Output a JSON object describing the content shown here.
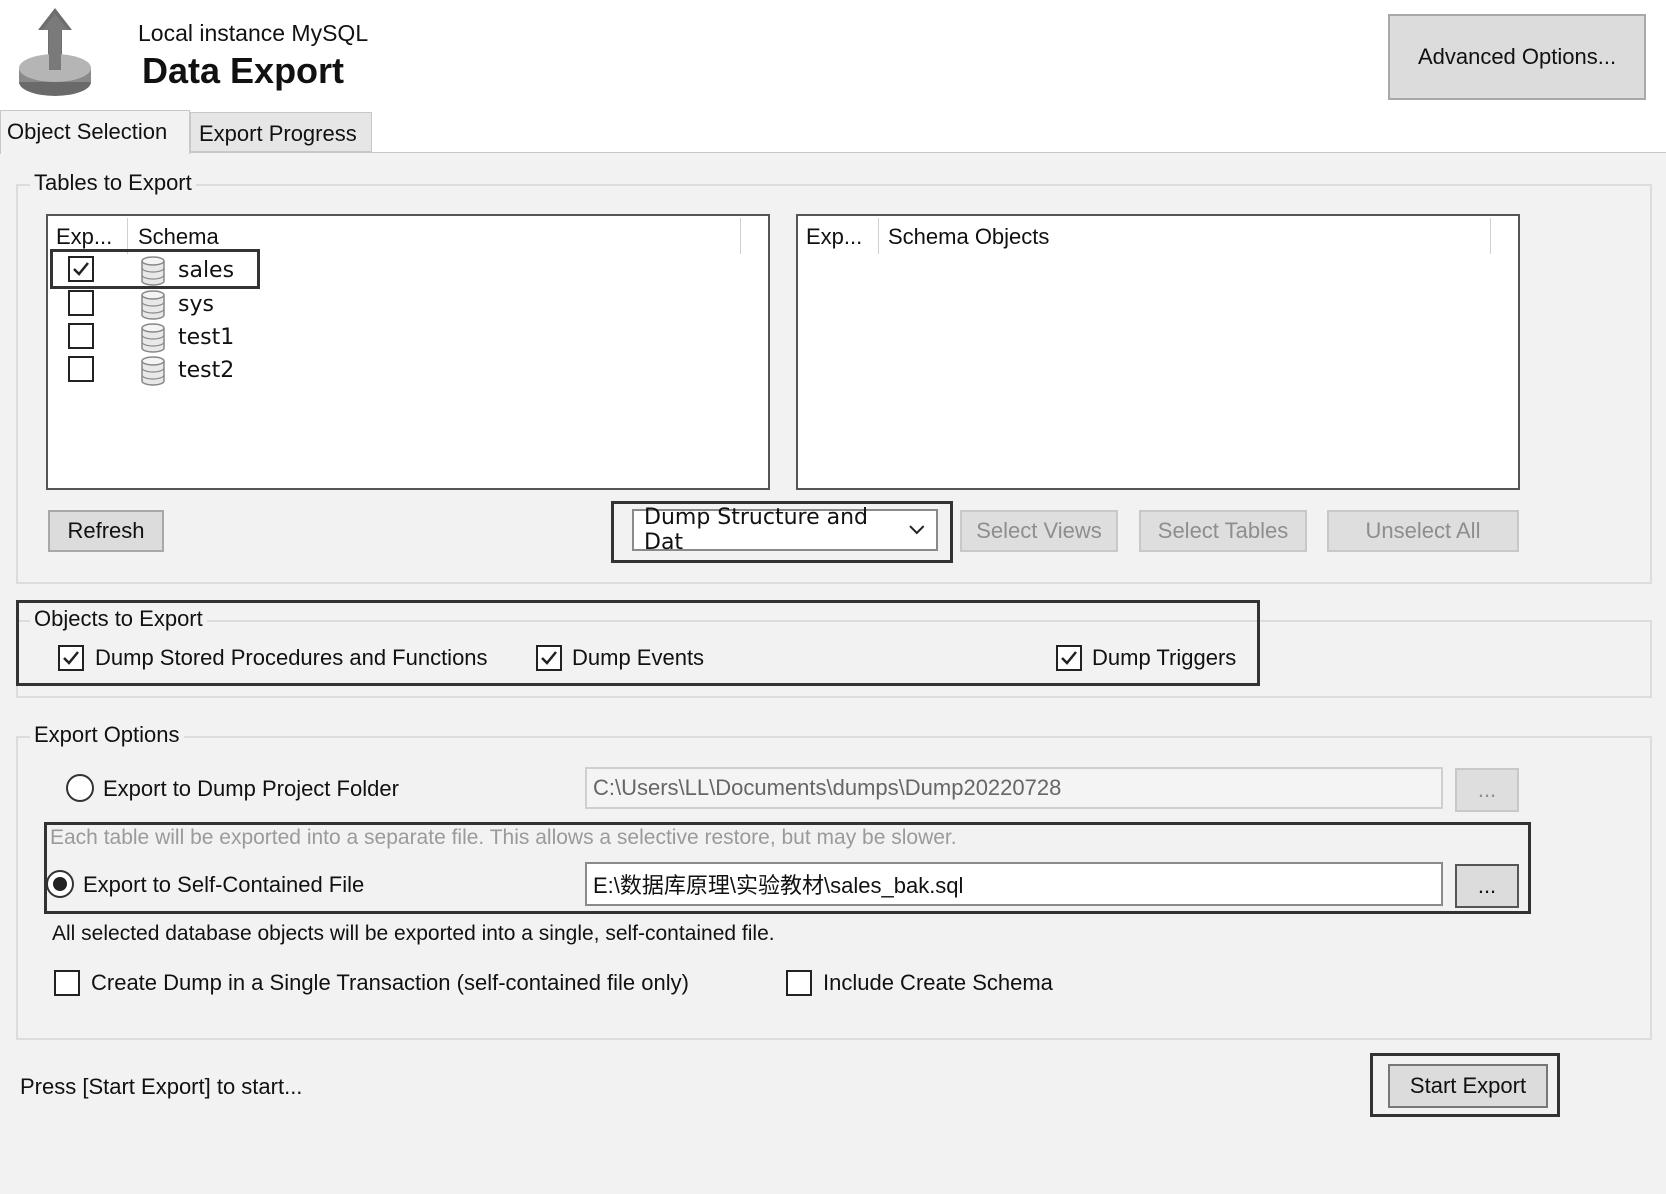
{
  "header": {
    "subtitle": "Local instance MySQL",
    "title": "Data Export",
    "advanced_button": "Advanced Options..."
  },
  "tabs": [
    {
      "label": "Object Selection",
      "active": true
    },
    {
      "label": "Export Progress",
      "active": false
    }
  ],
  "tables_to_export": {
    "group_label": "Tables to Export",
    "schema_list": {
      "columns": [
        "Exp...",
        "Schema"
      ],
      "rows": [
        {
          "name": "sales",
          "checked": true
        },
        {
          "name": "sys",
          "checked": false
        },
        {
          "name": "test1",
          "checked": false
        },
        {
          "name": "test2",
          "checked": false
        }
      ]
    },
    "objects_list": {
      "columns": [
        "Exp...",
        "Schema Objects"
      ]
    },
    "refresh_button": "Refresh",
    "dump_select": "Dump Structure and Dat",
    "select_views_button": "Select Views",
    "select_tables_button": "Select Tables",
    "unselect_all_button": "Unselect All"
  },
  "objects_to_export": {
    "group_label": "Objects to Export",
    "options": [
      {
        "label": "Dump Stored Procedures and Functions",
        "checked": true
      },
      {
        "label": "Dump Events",
        "checked": true
      },
      {
        "label": "Dump Triggers",
        "checked": true
      }
    ]
  },
  "export_options": {
    "group_label": "Export Options",
    "dump_folder_label": "Export to Dump Project Folder",
    "dump_folder_path": "C:\\Users\\LL\\Documents\\dumps\\Dump20220728",
    "dump_folder_hint": "Each table will be exported into a separate file. This allows a selective restore, but may be slower.",
    "self_contained_label": "Export to Self-Contained File",
    "self_contained_path": "E:\\数据库原理\\实验教材\\sales_bak.sql",
    "self_contained_note": "All selected database objects will be exported into a single, self-contained file.",
    "browse_label": "...",
    "single_transaction_label": "Create Dump in a Single Transaction (self-contained file only)",
    "include_schema_label": "Include Create Schema",
    "selected_mode": "self_contained"
  },
  "footer": {
    "status": "Press [Start Export] to start...",
    "start_button": "Start Export"
  },
  "icons": [
    "data-export-icon",
    "database-icon",
    "checkmark-icon",
    "chevron-down-icon"
  ]
}
